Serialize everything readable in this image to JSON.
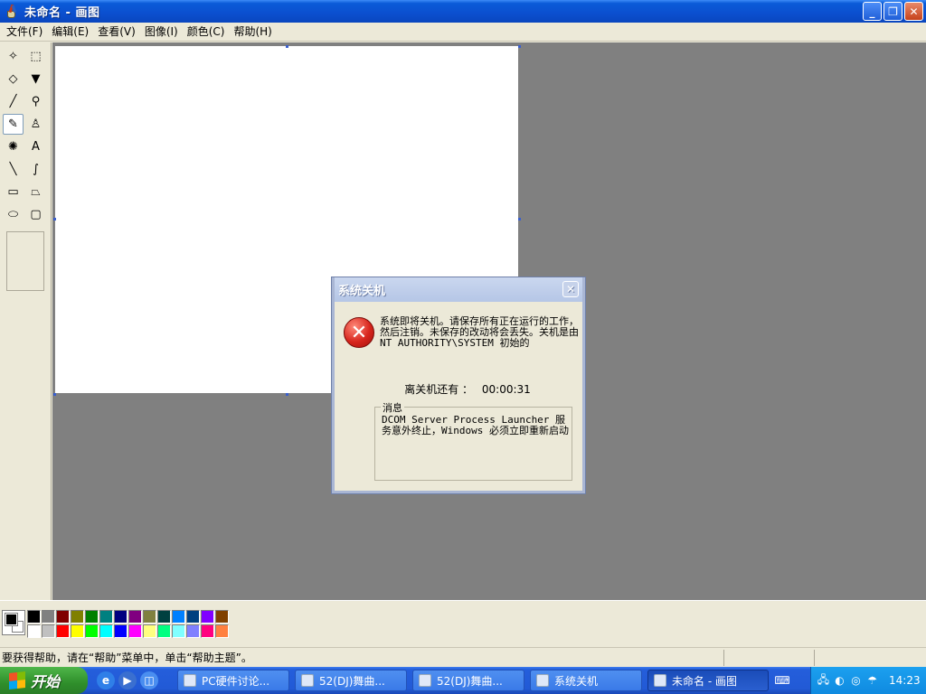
{
  "window": {
    "title": "未命名 - 画图",
    "minimize_glyph": "_",
    "restore_glyph": "❐",
    "close_glyph": "✕"
  },
  "menu": [
    {
      "label": "文件(F)"
    },
    {
      "label": "编辑(E)"
    },
    {
      "label": "查看(V)"
    },
    {
      "label": "图像(I)"
    },
    {
      "label": "颜色(C)"
    },
    {
      "label": "帮助(H)"
    }
  ],
  "tools": [
    {
      "name": "free-select-icon",
      "glyph": "✧"
    },
    {
      "name": "rect-select-icon",
      "glyph": "⬚"
    },
    {
      "name": "eraser-icon",
      "glyph": "◇"
    },
    {
      "name": "fill-bucket-icon",
      "glyph": "▼"
    },
    {
      "name": "color-picker-icon",
      "glyph": "╱"
    },
    {
      "name": "magnifier-icon",
      "glyph": "⚲"
    },
    {
      "name": "pencil-icon",
      "glyph": "✎"
    },
    {
      "name": "brush-icon",
      "glyph": "♙"
    },
    {
      "name": "airbrush-icon",
      "glyph": "✺"
    },
    {
      "name": "text-icon",
      "glyph": "A"
    },
    {
      "name": "line-icon",
      "glyph": "╲"
    },
    {
      "name": "curve-icon",
      "glyph": "∫"
    },
    {
      "name": "rectangle-icon",
      "glyph": "▭"
    },
    {
      "name": "polygon-icon",
      "glyph": "⏢"
    },
    {
      "name": "ellipse-icon",
      "glyph": "⬭"
    },
    {
      "name": "rounded-rect-icon",
      "glyph": "▢"
    }
  ],
  "palette": {
    "foreground": "#000000",
    "background": "#ffffff",
    "colors": [
      "#000000",
      "#808080",
      "#800000",
      "#808000",
      "#008000",
      "#008080",
      "#000080",
      "#800080",
      "#808040",
      "#004040",
      "#0080ff",
      "#004080",
      "#8000ff",
      "#804000",
      "#ffffff",
      "#c0c0c0",
      "#ff0000",
      "#ffff00",
      "#00ff00",
      "#00ffff",
      "#0000ff",
      "#ff00ff",
      "#ffff80",
      "#00ff80",
      "#80ffff",
      "#8080ff",
      "#ff0080",
      "#ff8040"
    ]
  },
  "status": {
    "text": "要获得帮助，请在“帮助”菜单中，单击“帮助主题”。"
  },
  "dialog": {
    "title": "系统关机",
    "close_glyph": "✕",
    "error_glyph": "✕",
    "message": "系统即将关机。请保存所有正在运行的工作，然后注销。未保存的改动将会丢失。关机是由 NT AUTHORITY\\SYSTEM 初始的",
    "countdown_label": "离关机还有 ：",
    "countdown_value": "00:00:31",
    "group_label": "消息",
    "group_message": "DCOM Server Process Launcher 服务意外终止，Windows 必须立即重新启动"
  },
  "taskbar": {
    "start_label": "开始",
    "tasks": [
      {
        "label": "PC硬件讨论..."
      },
      {
        "label": "52(DJ)舞曲..."
      },
      {
        "label": "52(DJ)舞曲..."
      },
      {
        "label": "系统关机"
      },
      {
        "label": "未命名 - 画图"
      }
    ],
    "clock": "14:23"
  }
}
